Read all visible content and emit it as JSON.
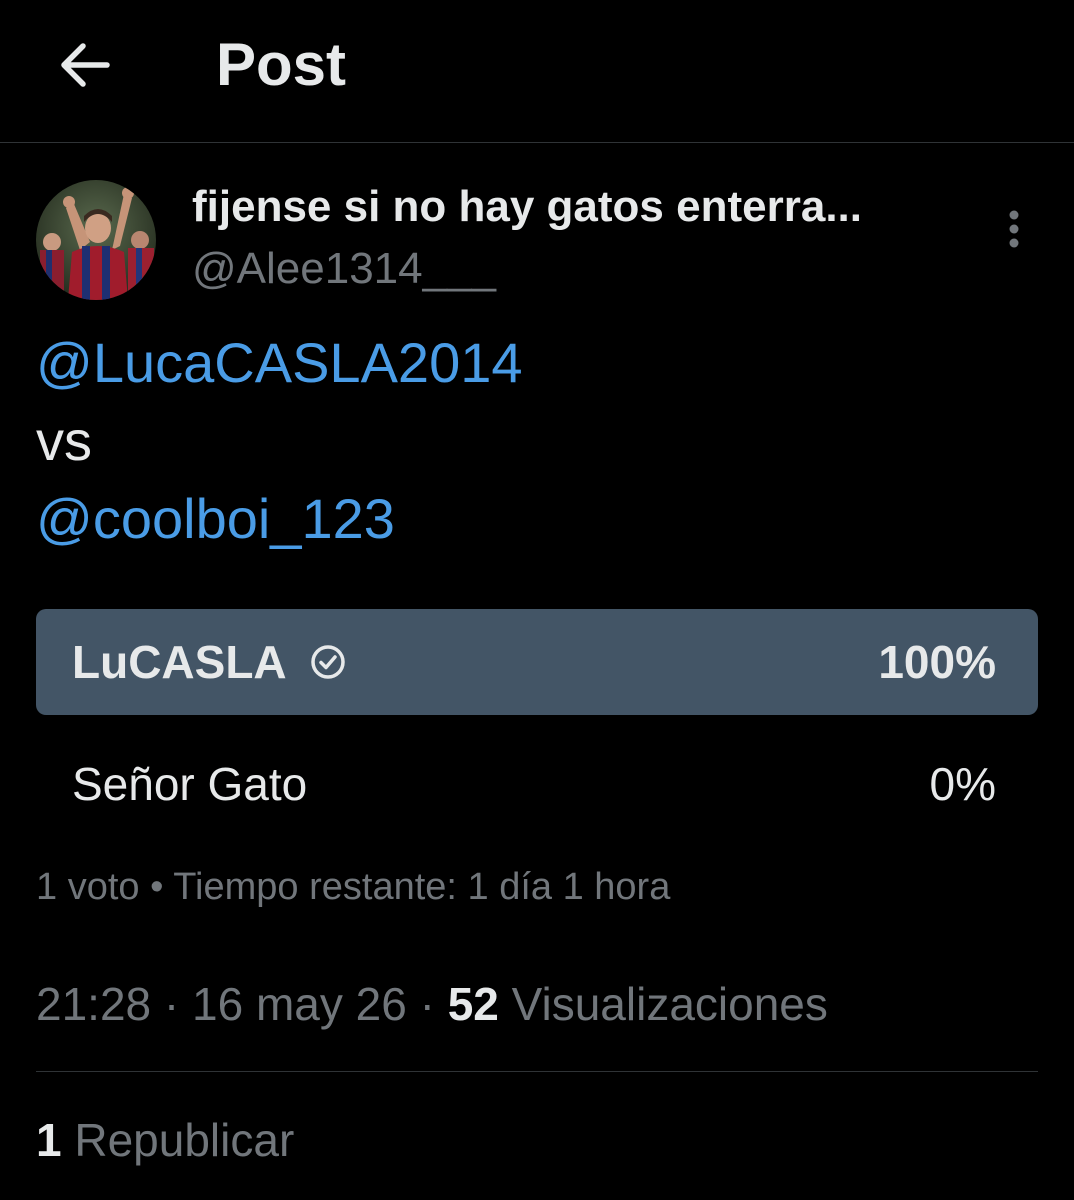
{
  "header": {
    "title": "Post",
    "back_icon": "arrow-left-icon"
  },
  "author": {
    "display_name": "fijense si no hay gatos enterra...",
    "handle": "@Alee1314___",
    "avatar_icon": "avatar-photo",
    "more_icon": "more-vertical-icon"
  },
  "post": {
    "lines": [
      {
        "text": "@LucaCASLA2014",
        "kind": "mention"
      },
      {
        "text": "vs",
        "kind": "plain"
      },
      {
        "text": "@coolboi_123",
        "kind": "mention"
      }
    ]
  },
  "poll": {
    "options": [
      {
        "label": "LuCASLA",
        "percent_label": "100%",
        "share": 1.0,
        "winner": true,
        "check_icon": "check-circle-icon"
      },
      {
        "label": "Señor Gato",
        "percent_label": "0%",
        "share": 0.0,
        "winner": false
      }
    ],
    "meta": "1 voto • Tiempo restante: 1 día 1 hora"
  },
  "details": {
    "time": "21:28",
    "date": "16 may 26",
    "separator": "·",
    "views_count": "52",
    "views_label": "Visualizaciones"
  },
  "stats": {
    "reposts_count": "1",
    "reposts_label": "Republicar"
  },
  "colors": {
    "background": "#000000",
    "text": "#e7e9ea",
    "muted": "#71767b",
    "mention": "#4a9ce6",
    "poll_fill": "#435566",
    "divider": "#2f3336"
  }
}
